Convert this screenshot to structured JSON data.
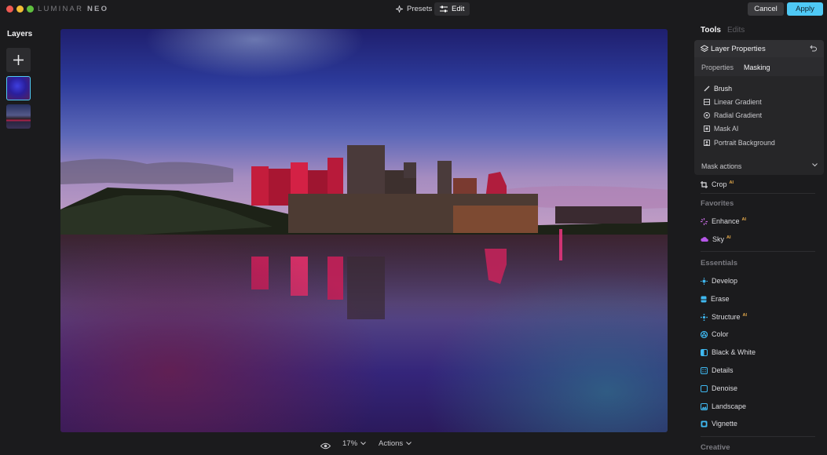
{
  "app": {
    "logo_light": "LUMINAR",
    "logo_bold": "NEO"
  },
  "topbar": {
    "presets_label": "Presets",
    "edit_label": "Edit",
    "cancel_label": "Cancel",
    "apply_label": "Apply",
    "presets_icon": "sparkle-icon",
    "edit_icon": "sliders-icon"
  },
  "layers": {
    "title": "Layers",
    "add_icon": "plus-icon"
  },
  "bottombar": {
    "eye_icon": "eye-icon",
    "zoom": "17%",
    "actions_label": "Actions"
  },
  "right": {
    "tabs": [
      "Tools",
      "Edits"
    ],
    "layer_properties": {
      "title": "Layer Properties",
      "subtabs": [
        "Properties",
        "Masking"
      ],
      "mask_tools": [
        "Brush",
        "Linear Gradient",
        "Radial Gradient",
        "Mask AI",
        "Portrait Background"
      ],
      "mask_actions": "Mask actions"
    },
    "crop": {
      "label": "Crop",
      "badge": "AI"
    },
    "sections": {
      "favorites": "Favorites",
      "essentials": "Essentials",
      "creative": "Creative"
    },
    "favorites": [
      {
        "label": "Enhance",
        "badge": "AI"
      },
      {
        "label": "Sky",
        "badge": "AI"
      }
    ],
    "essentials": [
      {
        "label": "Develop",
        "badge": ""
      },
      {
        "label": "Erase",
        "badge": ""
      },
      {
        "label": "Structure",
        "badge": "AI"
      },
      {
        "label": "Color",
        "badge": ""
      },
      {
        "label": "Black & White",
        "badge": ""
      },
      {
        "label": "Details",
        "badge": ""
      },
      {
        "label": "Denoise",
        "badge": ""
      },
      {
        "label": "Landscape",
        "badge": ""
      },
      {
        "label": "Vignette",
        "badge": ""
      }
    ]
  },
  "colors": {
    "accent": "#4fc9f5",
    "background": "#1b1b1d",
    "ai_badge": "#e2a84b"
  }
}
